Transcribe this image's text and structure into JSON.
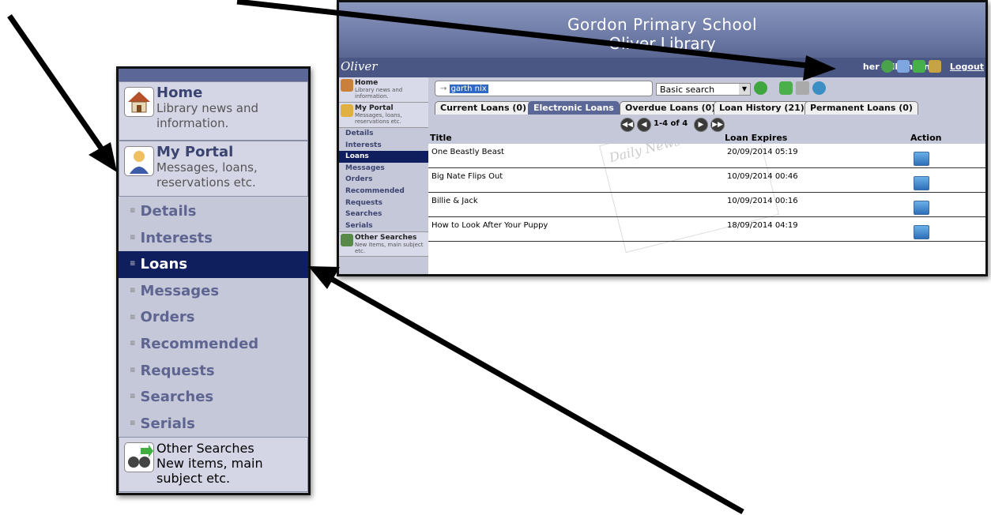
{
  "app": {
    "school_name": "Gordon Primary School",
    "library_name": "Oliver Library",
    "logo_text": "Oliver",
    "user_name": "her Wilkinson",
    "logout_label": "Logout"
  },
  "sidebar": {
    "home": {
      "title": "Home",
      "subtitle": "Library news and information."
    },
    "portal": {
      "title": "My Portal",
      "subtitle": "Messages, loans, reservations etc."
    },
    "items": [
      {
        "label": "Details"
      },
      {
        "label": "Interests"
      },
      {
        "label": "Loans",
        "active": true
      },
      {
        "label": "Messages"
      },
      {
        "label": "Orders"
      },
      {
        "label": "Recommended"
      },
      {
        "label": "Requests"
      },
      {
        "label": "Searches"
      },
      {
        "label": "Serials"
      }
    ],
    "other": {
      "title": "Other Searches",
      "subtitle": "New items, main subject etc."
    }
  },
  "search": {
    "value": "garth nix",
    "mode": "Basic search"
  },
  "tabs": [
    {
      "label": "Current Loans (0)"
    },
    {
      "label": "Electronic Loans",
      "selected": true
    },
    {
      "label": "Overdue Loans (0)"
    },
    {
      "label": "Loan History (21)"
    },
    {
      "label": "Permanent Loans (0)"
    }
  ],
  "pager": {
    "text": "1-4 of 4"
  },
  "table": {
    "headers": {
      "title": "Title",
      "expires": "Loan Expires",
      "action": "Action"
    },
    "rows": [
      {
        "title": "One Beastly Beast",
        "expires": "20/09/2014 05:19"
      },
      {
        "title": "Big Nate Flips Out",
        "expires": "10/09/2014 00:46"
      },
      {
        "title": "Billie & Jack",
        "expires": "10/09/2014 00:16"
      },
      {
        "title": "How to Look After Your Puppy",
        "expires": "18/09/2014 04:19"
      }
    ]
  },
  "decoration": {
    "newspaper_text": "Daily News"
  },
  "colors": {
    "banner": "#6e7ba6",
    "sidebar_bg": "#c5c8d9",
    "active_item": "#0f1f5e",
    "selected_tab": "#5b6796"
  }
}
